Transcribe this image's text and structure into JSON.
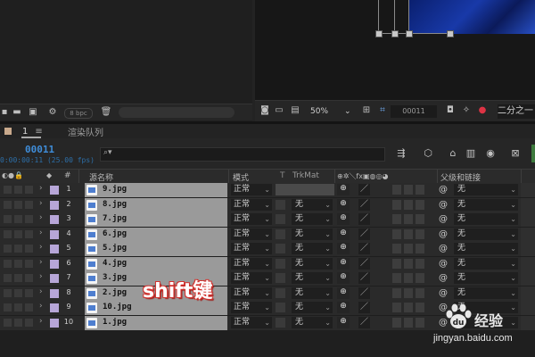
{
  "project": {
    "bpc": "8 bpc"
  },
  "viewer": {
    "zoom": "50%",
    "timecode": "00011",
    "resolution": "二分之一"
  },
  "tabs": [
    {
      "label": "1"
    },
    {
      "label": "渲染队列"
    }
  ],
  "comp": {
    "timecode": "00011",
    "fps": "0:00:00:11 (25.00 fps)",
    "search_placeholder": ""
  },
  "columns": {
    "number": "#",
    "source_name": "源名称",
    "mode": "模式",
    "t": "T",
    "trkmat": "TrkMat",
    "parent": "父级和链接"
  },
  "layers": [
    {
      "num": "1",
      "name": "9.jpg",
      "mode": "正常",
      "trkmat": "",
      "parent": "无"
    },
    {
      "num": "2",
      "name": "8.jpg",
      "mode": "正常",
      "trkmat": "无",
      "parent": "无"
    },
    {
      "num": "3",
      "name": "7.jpg",
      "mode": "正常",
      "trkmat": "无",
      "parent": "无"
    },
    {
      "num": "4",
      "name": "6.jpg",
      "mode": "正常",
      "trkmat": "无",
      "parent": "无"
    },
    {
      "num": "5",
      "name": "5.jpg",
      "mode": "正常",
      "trkmat": "无",
      "parent": "无"
    },
    {
      "num": "6",
      "name": "4.jpg",
      "mode": "正常",
      "trkmat": "无",
      "parent": "无"
    },
    {
      "num": "7",
      "name": "3.jpg",
      "mode": "正常",
      "trkmat": "无",
      "parent": "无"
    },
    {
      "num": "8",
      "name": "2.jpg",
      "mode": "正常",
      "trkmat": "无",
      "parent": "无"
    },
    {
      "num": "9",
      "name": "10.jpg",
      "mode": "正常",
      "trkmat": "无",
      "parent": "无"
    },
    {
      "num": "10",
      "name": "1.jpg",
      "mode": "正常",
      "trkmat": "无",
      "parent": "无"
    }
  ],
  "caption": "shift键",
  "watermark": {
    "brand": "经验",
    "url": "jingyan.baidu.com"
  },
  "colors": {
    "timecode_blue": "#3f8dd9",
    "label_lavender": "#b7a6d8",
    "caption_outline": "#d2332f"
  }
}
